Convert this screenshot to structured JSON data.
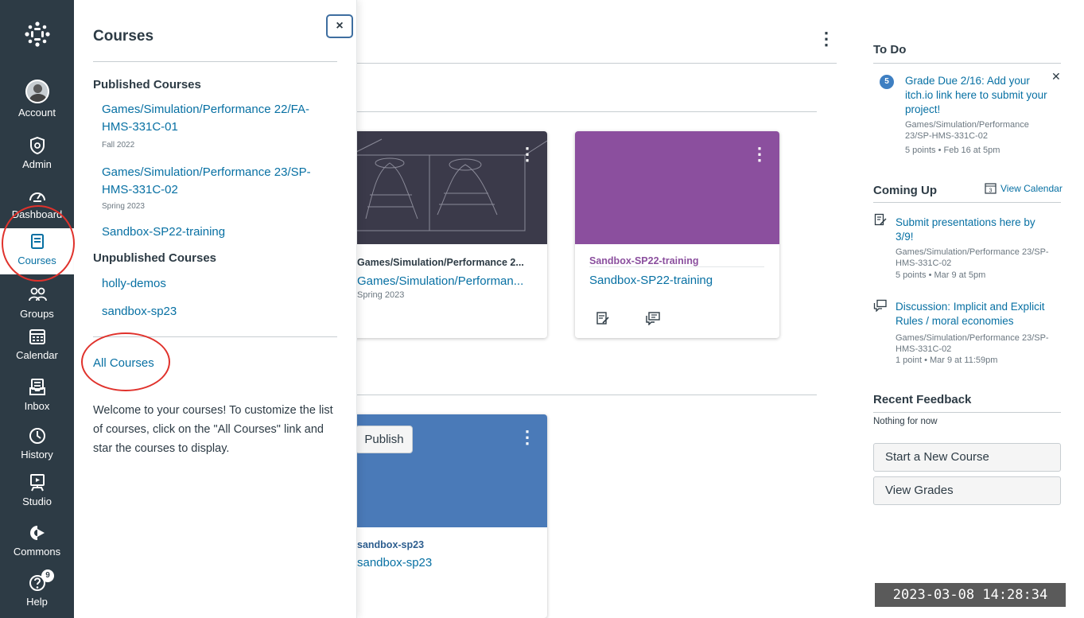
{
  "global_nav": {
    "items": [
      {
        "label": "Account",
        "icon": "avatar"
      },
      {
        "label": "Admin",
        "icon": "shield-icon"
      },
      {
        "label": "Dashboard",
        "icon": "dashboard-icon"
      },
      {
        "label": "Courses",
        "icon": "courses-icon"
      },
      {
        "label": "Groups",
        "icon": "groups-icon"
      },
      {
        "label": "Calendar",
        "icon": "calendar-icon"
      },
      {
        "label": "Inbox",
        "icon": "inbox-icon"
      },
      {
        "label": "History",
        "icon": "clock-icon"
      },
      {
        "label": "Studio",
        "icon": "studio-icon"
      },
      {
        "label": "Commons",
        "icon": "commons-icon"
      },
      {
        "label": "Help",
        "icon": "help-icon",
        "badge": "9"
      }
    ]
  },
  "tray": {
    "title": "Courses",
    "close_label": "×",
    "published_heading": "Published Courses",
    "published": [
      {
        "name": "Games/Simulation/Performance 22/FA-HMS-331C-01",
        "term": "Fall 2022"
      },
      {
        "name": "Games/Simulation/Performance 23/SP-HMS-331C-02",
        "term": "Spring 2023"
      },
      {
        "name": "Sandbox-SP22-training",
        "term": ""
      }
    ],
    "unpublished_heading": "Unpublished Courses",
    "unpublished": [
      {
        "name": "holly-demos"
      },
      {
        "name": "sandbox-sp23"
      }
    ],
    "all_courses": "All Courses",
    "welcome": "Welcome to your courses! To customize the list of courses, click on the \"All Courses\" link and star the courses to display."
  },
  "dashboard": {
    "cards": [
      {
        "title": "Games/Simulation/Performance 2...",
        "subtitle": "Games/Simulation/Performan...",
        "term": "Spring 2023",
        "color": "#3b3a4a"
      },
      {
        "title": "Sandbox-SP22-training",
        "subtitle": "Sandbox-SP22-training",
        "term": "",
        "color": "#8b4f9e"
      },
      {
        "title": "sandbox-sp23",
        "subtitle": "sandbox-sp23",
        "term": "",
        "color": "#4a7ab8"
      }
    ],
    "publish_label": "Publish"
  },
  "sidebar": {
    "todo_title": "To Do",
    "todo": {
      "badge": "5",
      "title": "Grade Due 2/16: Add your itch.io link here to submit your project!",
      "course": "Games/Simulation/Performance 23/SP-HMS-331C-02",
      "meta": "5 points • Feb 16 at 5pm"
    },
    "coming_up_title": "Coming Up",
    "view_calendar": "View Calendar",
    "calendar_day": "3",
    "coming_up": [
      {
        "title": "Submit presentations here by 3/9!",
        "course": "Games/Simulation/Performance 23/SP-HMS-331C-02",
        "meta": "5 points • Mar 9 at 5pm",
        "icon": "assignment-icon"
      },
      {
        "title": "Discussion: Implicit and Explicit Rules / moral economies",
        "course": "Games/Simulation/Performance 23/SP-HMS-331C-02",
        "meta": "1 point • Mar 9 at 11:59pm",
        "icon": "discussion-icon"
      }
    ],
    "recent_feedback_title": "Recent Feedback",
    "recent_feedback_empty": "Nothing for now",
    "start_course": "Start a New Course",
    "view_grades": "View Grades"
  },
  "overlay": {
    "timestamp": "2023-03-08 14:28:34"
  },
  "colors": {
    "nav_bg": "#2d3b45",
    "link": "#0770a3",
    "annotation": "#e0322c"
  }
}
